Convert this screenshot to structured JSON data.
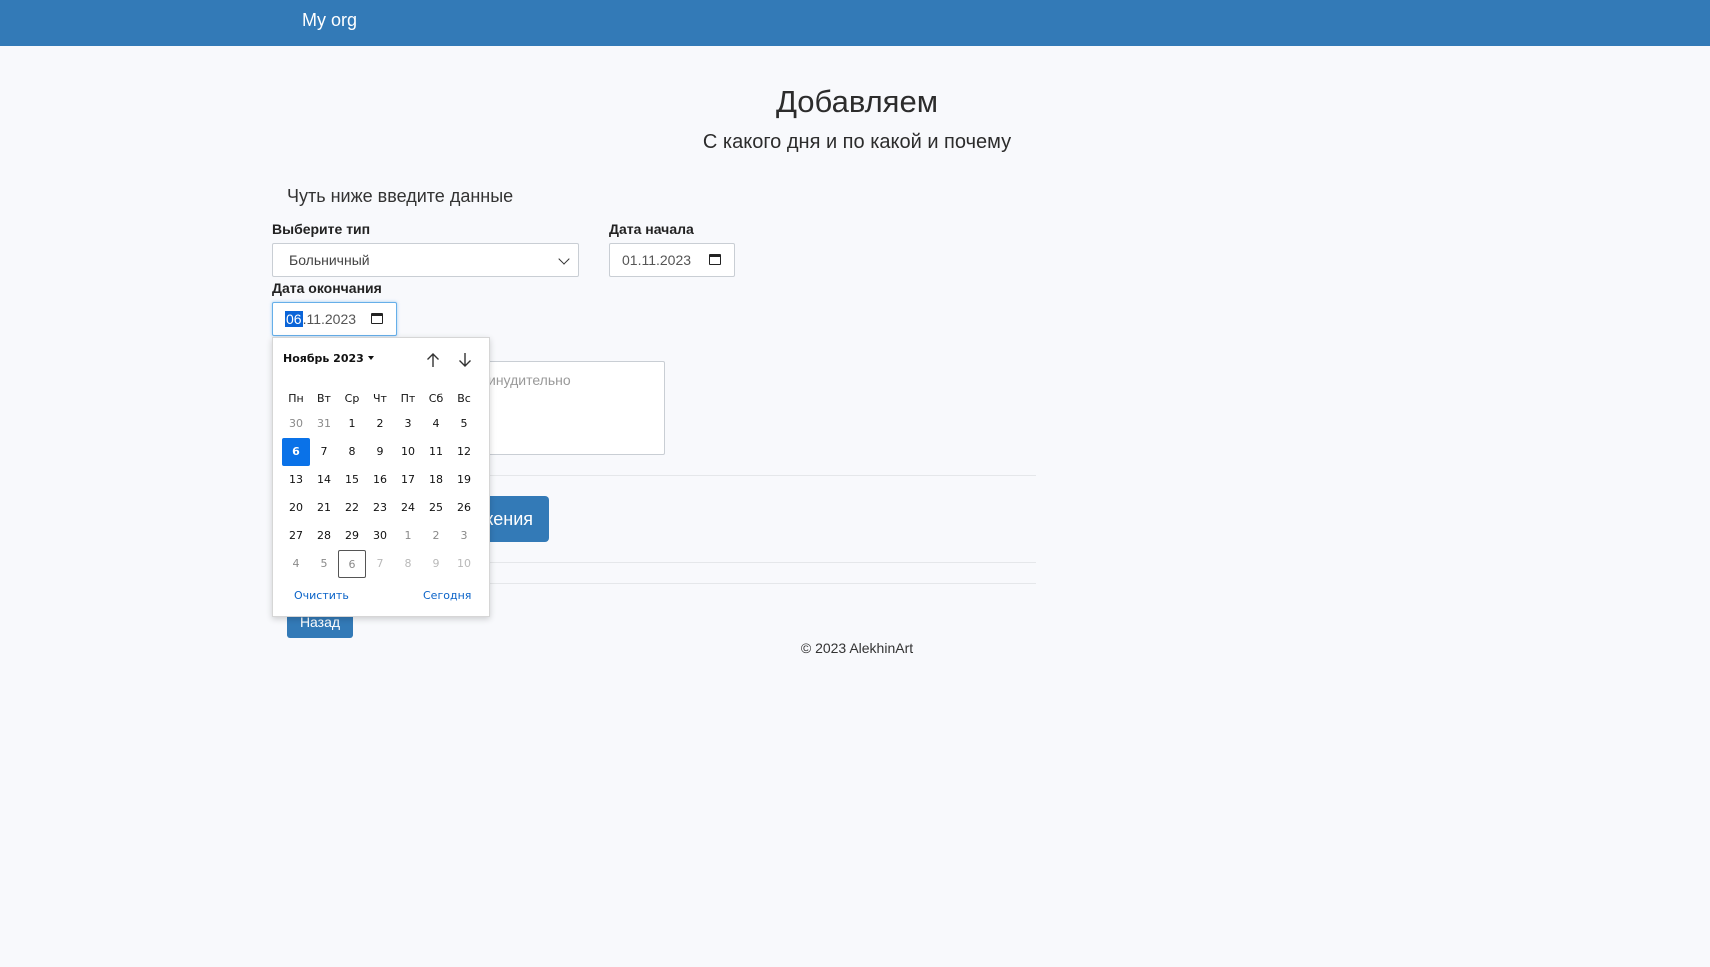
{
  "navbar": {
    "brand": "My org",
    "color": "#337ab7"
  },
  "header": {
    "title": "Добавляем",
    "subtitle": "С какого дня и по какой и почему"
  },
  "form": {
    "hint": "Чуть ниже введите данные",
    "type_label": "Выберите тип",
    "type_value": "Больничный",
    "start_label": "Дата начала",
    "start_value": "01.11.2023",
    "end_label": "Дата окончания",
    "end_value_day": "06",
    "end_value_rest": ".11.2023",
    "comment_visible_placeholder": "инудительно",
    "submit_label_visible": "жения",
    "back_label": "Назад"
  },
  "calendar": {
    "month_label": "Ноябрь 2023",
    "weekdays": [
      "Пн",
      "Вт",
      "Ср",
      "Чт",
      "Пт",
      "Сб",
      "Вс"
    ],
    "weeks": [
      [
        "30",
        "31",
        "1",
        "2",
        "3",
        "4",
        "5"
      ],
      [
        "6",
        "7",
        "8",
        "9",
        "10",
        "11",
        "12"
      ],
      [
        "13",
        "14",
        "15",
        "16",
        "17",
        "18",
        "19"
      ],
      [
        "20",
        "21",
        "22",
        "23",
        "24",
        "25",
        "26"
      ],
      [
        "27",
        "28",
        "29",
        "30",
        "1",
        "2",
        "3"
      ],
      [
        "4",
        "5",
        "6",
        "7",
        "8",
        "9",
        "10"
      ]
    ],
    "selected_day": "6",
    "clear_label": "Очистить",
    "today_label": "Сегодня",
    "selected_color": "#0a72e8"
  },
  "footer": {
    "text": "© 2023 AlekhinArt"
  }
}
